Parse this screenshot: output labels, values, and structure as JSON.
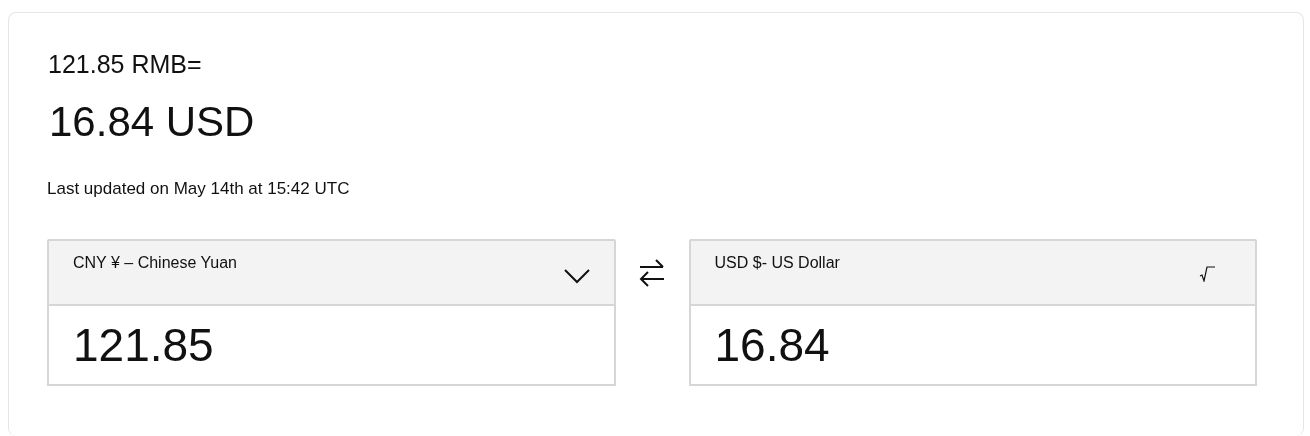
{
  "summary": {
    "from_text": "121.85 RMB=",
    "result": "16.84 USD",
    "updated": "Last updated on May 14th at 15:42 UTC"
  },
  "converters": [
    {
      "currency": "CNY ¥ – Chinese Yuan",
      "amount": "121.85",
      "kind": "dropdown"
    },
    {
      "currency": "USD $- US Dollar",
      "amount": "16.84",
      "kind": "formula"
    }
  ]
}
